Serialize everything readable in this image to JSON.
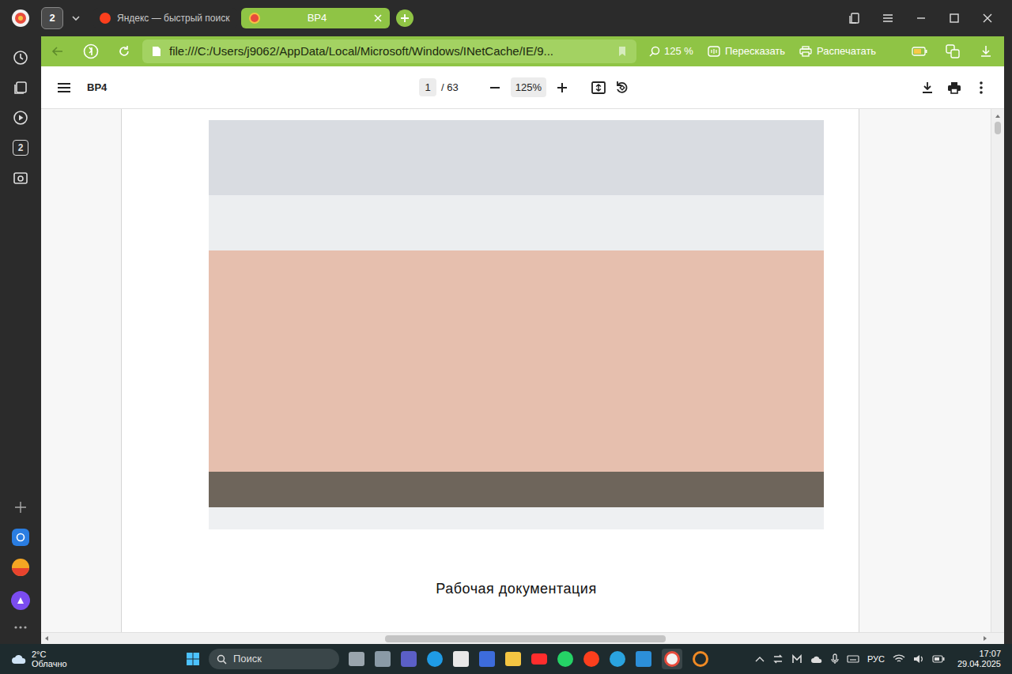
{
  "window": {
    "tab_count": "2",
    "tabs": [
      {
        "label": "Яндекс — быстрый поиск",
        "selected": false
      },
      {
        "label": "ВР4",
        "selected": true
      }
    ]
  },
  "sidebar": {
    "badge": "2"
  },
  "address_bar": {
    "url": "file:///C:/Users/j9062/AppData/Local/Microsoft/Windows/INetCache/IE/9...",
    "zoom": "125 %",
    "buttons": [
      "Пересказать",
      "Распечатать"
    ]
  },
  "pdf_viewer": {
    "title": "ВР4",
    "page": "1",
    "page_total": "/ 63",
    "zoom": "125%",
    "caption": "Рабочая документация"
  },
  "taskbar": {
    "temperature": "2°C",
    "weather": "Облачно",
    "search": "Поиск",
    "language": "РУС",
    "time": "17:07",
    "date": "29.04.2025"
  }
}
